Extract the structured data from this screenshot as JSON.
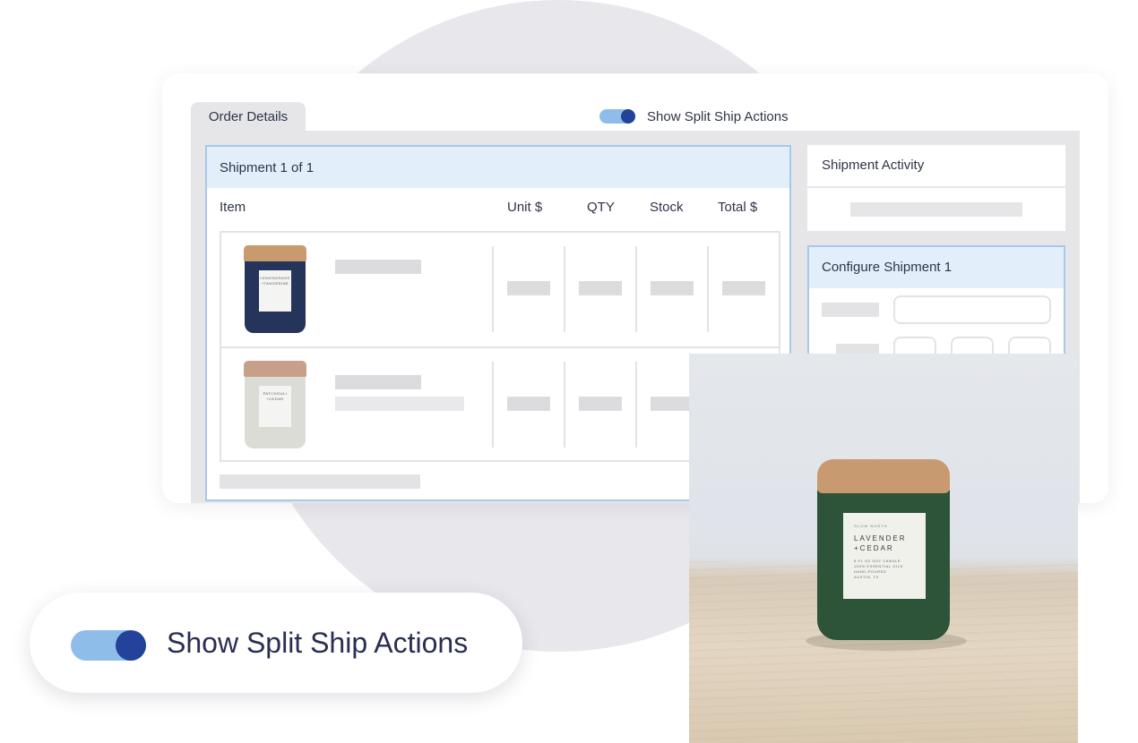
{
  "card": {
    "tab_label": "Order Details",
    "toggle_label": "Show Split Ship Actions",
    "toggle_on": true
  },
  "shipment": {
    "title": "Shipment 1 of 1",
    "columns": [
      "Item",
      "Unit $",
      "QTY",
      "Stock",
      "Total $"
    ],
    "items": [
      {
        "product": "Lemongrass + Tangerine candle",
        "label_text": "LEMONGRASS +TANGERINE"
      },
      {
        "product": "Patchouli + Cedar candle",
        "label_text": "PATCHOULI +CEDAR"
      }
    ]
  },
  "activity": {
    "title": "Shipment Activity"
  },
  "configure": {
    "title": "Configure Shipment 1"
  },
  "photo": {
    "brand": "GLOW NORTH",
    "name_line1": "LAVENDER",
    "name_line2": "+CEDAR",
    "desc_line1": "8 FL OZ SOY CANDLE",
    "desc_line2": "100% ESSENTIAL OILS",
    "desc_line3": "HAND-POURED",
    "desc_line4": "AUSTIN, TX"
  },
  "callout": {
    "toggle_label": "Show Split Ship Actions",
    "toggle_on": true
  },
  "colors": {
    "accent_blue": "#23429a",
    "toggle_track": "#8fbdea",
    "panel_highlight": "#e3eefb",
    "panel_border": "#a7c7ec"
  }
}
